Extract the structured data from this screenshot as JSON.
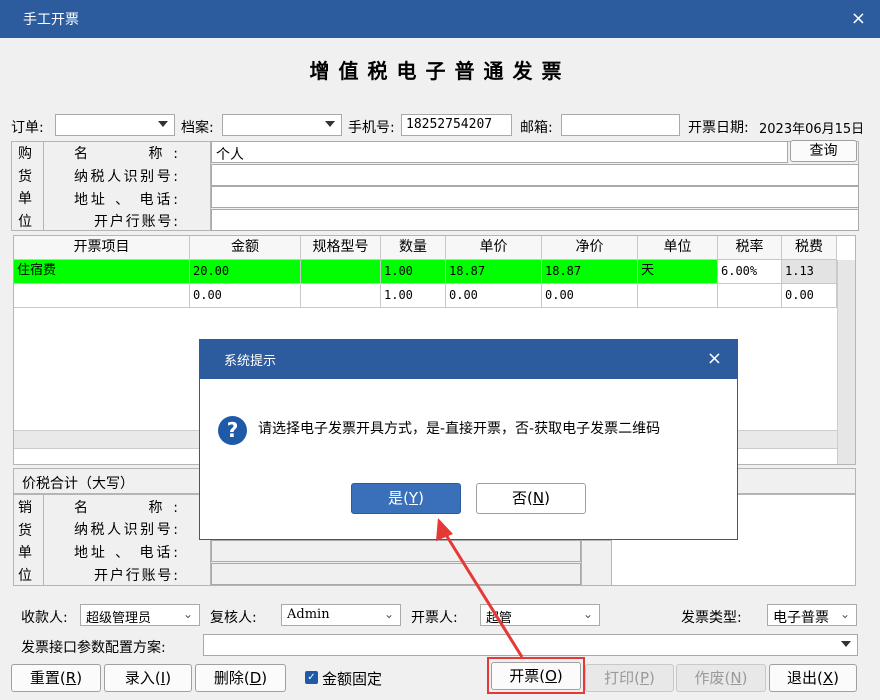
{
  "window": {
    "title": "手工开票",
    "close_glyph": "×"
  },
  "doc_title": "增值税电子普通发票",
  "top": {
    "order_label": "订单:",
    "order_value": "",
    "archive_label": "档案:",
    "archive_value": "",
    "phone_label": "手机号:",
    "phone_value": "18252754207",
    "email_label": "邮箱:",
    "email_value": "",
    "date_label": "开票日期:",
    "date_value": "2023年06月15日"
  },
  "buyer": {
    "side_chars": [
      "购",
      "货",
      "单",
      "位"
    ],
    "name_label": "名　　称:",
    "name_value": "个人",
    "taxid_label": "纳税人识别号:",
    "taxid_value": "",
    "addr_label": "地址 、 电话:",
    "addr_value": "",
    "bank_label": "开户行账号:",
    "bank_value": "",
    "query_button": "查询"
  },
  "table": {
    "columns": [
      "开票项目",
      "金额",
      "规格型号",
      "数量",
      "单价",
      "净价",
      "单位",
      "税率",
      "税费"
    ],
    "rows": [
      [
        "住宿费",
        "20.00",
        "",
        "1.00",
        "18.87",
        "18.87",
        "天",
        "6.00%",
        "1.13"
      ],
      [
        "",
        "0.00",
        "",
        "1.00",
        "0.00",
        "0.00",
        "",
        "",
        "0.00"
      ]
    ]
  },
  "total_label": "价税合计（大写）",
  "seller": {
    "side_chars": [
      "销",
      "货",
      "单",
      "位"
    ],
    "name_label": "名　　称:",
    "taxid_label": "纳税人识别号:",
    "addr_label": "地址 、 电话:",
    "bank_label": "开户行账号:"
  },
  "footer": {
    "payee_label": "收款人:",
    "payee_value": "超级管理员",
    "reviewer_label": "复核人:",
    "reviewer_value": "Admin",
    "issuer_label": "开票人:",
    "issuer_value": "超管",
    "invoice_type_label": "发票类型:",
    "invoice_type_value": "电子普票",
    "config_label": "发票接口参数配置方案:",
    "config_value": ""
  },
  "buttons": {
    "reset": "重置",
    "reset_key": "R",
    "enter": "录入",
    "enter_key": "I",
    "delete": "删除",
    "delete_key": "D",
    "fixed_amount": "金额固定",
    "issue": "开票",
    "issue_key": "O",
    "print": "打印",
    "print_key": "P",
    "void": "作废",
    "void_key": "N",
    "exit": "退出",
    "exit_key": "X"
  },
  "dialog": {
    "title": "系统提示",
    "close_glyph": "×",
    "message": "请选择电子发票开具方式，是-直接开票，否-获取电子发票二维码",
    "yes": "是",
    "yes_key": "Y",
    "no": "否",
    "no_key": "N"
  },
  "colors": {
    "titlebar": "#2c5b9e",
    "row_highlight": "#00ff00",
    "annotation": "#e53935"
  }
}
